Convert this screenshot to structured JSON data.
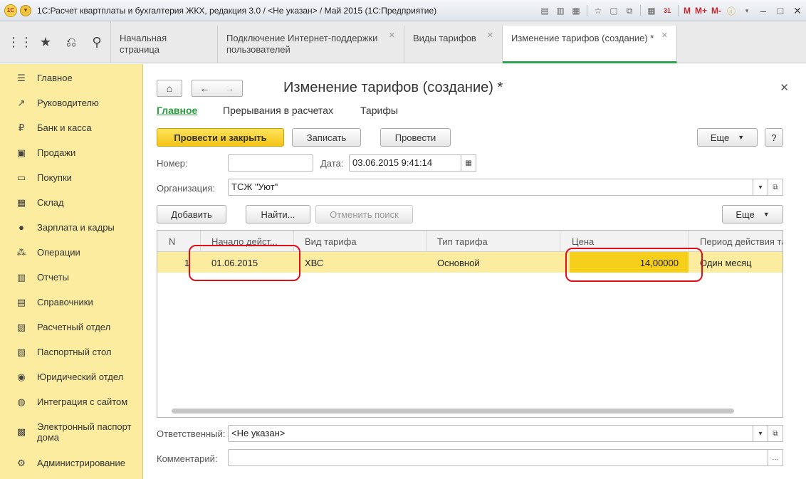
{
  "window": {
    "title": "1С:Расчет квартплаты и бухгалтерия ЖКХ, редакция 3.0 / <Не указан> / Май 2015  (1С:Предприятие)",
    "logo_text": "1С",
    "toolbar_m": "M",
    "toolbar_mplus": "M+",
    "toolbar_mminus": "M-",
    "calendar_day": "31"
  },
  "tabs": [
    {
      "label": "Начальная страница"
    },
    {
      "label": "Подключение Интернет-поддержки пользователей"
    },
    {
      "label": "Виды тарифов"
    },
    {
      "label": "Изменение тарифов (создание) *"
    }
  ],
  "sidebar": {
    "items": [
      {
        "label": "Главное"
      },
      {
        "label": "Руководителю"
      },
      {
        "label": "Банк и касса"
      },
      {
        "label": "Продажи"
      },
      {
        "label": "Покупки"
      },
      {
        "label": "Склад"
      },
      {
        "label": "Зарплата и кадры"
      },
      {
        "label": "Операции"
      },
      {
        "label": "Отчеты"
      },
      {
        "label": "Справочники"
      },
      {
        "label": "Расчетный отдел"
      },
      {
        "label": "Паспортный стол"
      },
      {
        "label": "Юридический отдел"
      },
      {
        "label": "Интеграция с сайтом"
      },
      {
        "label": "Электронный паспорт дома"
      },
      {
        "label": "Администрирование"
      }
    ]
  },
  "form": {
    "title": "Изменение тарифов (создание) *",
    "subnav": [
      "Главное",
      "Прерывания в расчетах",
      "Тарифы"
    ],
    "buttons": {
      "post_close": "Провести и закрыть",
      "save": "Записать",
      "post": "Провести",
      "more": "Еще",
      "help": "?",
      "add": "Добавить",
      "find": "Найти...",
      "cancel_search": "Отменить поиск",
      "more2": "Еще"
    },
    "fields": {
      "number_label": "Номер:",
      "number_value": "",
      "date_label": "Дата:",
      "date_value": "03.06.2015  9:41:14",
      "org_label": "Организация:",
      "org_value": "ТСЖ \"Уют\"",
      "responsible_label": "Ответственный:",
      "responsible_value": "<Не указан>",
      "comment_label": "Комментарий:",
      "comment_value": ""
    },
    "table": {
      "columns": [
        "N",
        "Начало дейст...",
        "Вид тарифа",
        "Тип тарифа",
        "Цена",
        "Период действия та"
      ],
      "rows": [
        {
          "n": "1",
          "start": "01.06.2015",
          "kind": "ХВС",
          "type": "Основной",
          "price": "14,00000",
          "period": "Один месяц"
        }
      ]
    }
  },
  "colors": {
    "sidebar_bg": "#fbeca0",
    "primary_button": "#f4c417",
    "active_tab": "#2fa34f",
    "highlight": "#e0101a"
  }
}
